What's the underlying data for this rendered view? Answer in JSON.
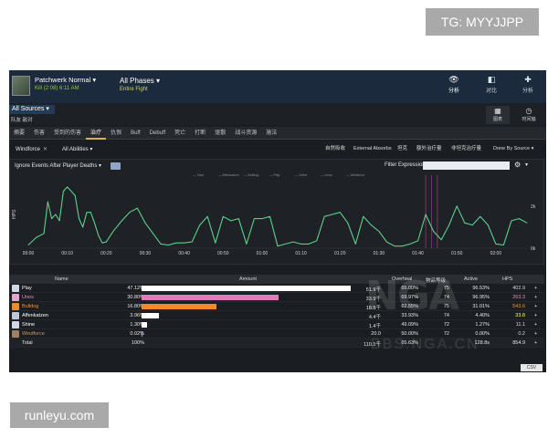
{
  "badges": {
    "tg": "TG: MYYJJPP",
    "site": "runleyu.com"
  },
  "header": {
    "boss_name": "Patchwerk Normal ▾",
    "kill_info": "Kill (2:08)  6:11 AM",
    "phase_title": "All Phases ▾",
    "phase_sub": "Entire Fight",
    "buttons": [
      {
        "icon": "eye-icon",
        "glyph": "👁",
        "label": "分析"
      },
      {
        "icon": "compare-icon",
        "glyph": "◧",
        "label": "对比"
      },
      {
        "icon": "puzzle-icon",
        "glyph": "✚",
        "label": "分析"
      }
    ]
  },
  "sources": {
    "label": "All Sources ▾",
    "sub": "队友  敌对",
    "views": [
      {
        "icon": "grid-icon",
        "glyph": "▦",
        "label": "图表"
      },
      {
        "icon": "clock-icon",
        "glyph": "◷",
        "label": "时间轴"
      }
    ]
  },
  "tabs": [
    "摘要",
    "伤害",
    "受到的伤害",
    "治疗",
    "仇恨",
    "Buff",
    "Debuff",
    "死亡",
    "打断",
    "驱散",
    "战斗资源",
    "施法"
  ],
  "active_tab": 3,
  "filters": {
    "source": "Windforce",
    "ability": "All Abilities ▾",
    "buttons": [
      "自然吸收",
      "External Absorbs",
      "坦克",
      "额外治疗量",
      "非坦克治疗量"
    ],
    "selected_button": 2,
    "sort": "Done By Source ▾"
  },
  "chart_panel": {
    "ignore_label": "Ignore Events After Player Deaths ▾",
    "filter_label": "Filter Expression:",
    "filter_value": "",
    "y_label": "HPS",
    "legend": [
      "— Total",
      "— Affenkatzen",
      "— Bulldog",
      "— Play",
      "— Shine",
      "— Unos",
      "— Windforce"
    ]
  },
  "chart_data": {
    "type": "line",
    "x_ticks": [
      "00:00",
      "00:10",
      "00:20",
      "00:30",
      "00:40",
      "00:50",
      "01:00",
      "01:10",
      "01:20",
      "01:30",
      "01:40",
      "01:50",
      "02:00"
    ],
    "y_ticks": [
      "2k",
      "0k"
    ],
    "xlim": [
      0,
      128
    ],
    "ylim": [
      0,
      3200
    ],
    "x": [
      0,
      2,
      4,
      5,
      6,
      7,
      8,
      9,
      10,
      12,
      13,
      14,
      15,
      16,
      17,
      18,
      19,
      20,
      22,
      24,
      26,
      28,
      30,
      32,
      34,
      36,
      38,
      40,
      42,
      44,
      46,
      48,
      50,
      52,
      54,
      56,
      58,
      60,
      62,
      64,
      66,
      68,
      70,
      72,
      74,
      76,
      78,
      80,
      82,
      84,
      86,
      88,
      90,
      92,
      94,
      96,
      98,
      100,
      102,
      104,
      106,
      108,
      110,
      112,
      114,
      116,
      118,
      120,
      122,
      124,
      126,
      128
    ],
    "y": [
      150,
      500,
      700,
      2200,
      1400,
      1600,
      1300,
      2700,
      2900,
      2500,
      1400,
      1000,
      1700,
      1700,
      1200,
      600,
      250,
      300,
      850,
      1300,
      1700,
      1900,
      1200,
      700,
      200,
      150,
      250,
      250,
      300,
      1100,
      1500,
      250,
      1500,
      1300,
      1400,
      200,
      1400,
      1400,
      1500,
      100,
      200,
      300,
      200,
      200,
      350,
      1500,
      1600,
      1700,
      1200,
      200,
      1500,
      1100,
      800,
      300,
      100,
      100,
      200,
      350,
      1600,
      800,
      400,
      1100,
      2000,
      1200,
      1100,
      1500,
      1100,
      200,
      150,
      1300,
      1400,
      1200
    ]
  },
  "table": {
    "headers": [
      "Name",
      "Amount",
      "Overheal",
      "物品等级",
      "Active",
      "HPS"
    ],
    "rows": [
      {
        "name": "Play",
        "icon": "priest-icon",
        "icon_color": "#d0d8e8",
        "name_color": "#ffffff",
        "pct": "47.12%",
        "fill": 0.9712,
        "bar_color": "#ffffff",
        "amount": "51.9千",
        "overheal": "65.00%",
        "ilvl": "75",
        "active": "96.53%",
        "hps": "402.9",
        "hps_color": "#d6dae0"
      },
      {
        "name": "Unos",
        "icon": "paladin-icon",
        "icon_color": "#e3a6d0",
        "name_color": "#e88fc0",
        "pct": "30.80%",
        "fill": 0.6348,
        "bar_color": "#e07ab8",
        "amount": "33.9千",
        "overheal": "69.97%",
        "ilvl": "74",
        "active": "96.95%",
        "hps": "263.3",
        "hps_color": "#e88fc0"
      },
      {
        "name": "Bulldog",
        "icon": "druid-icon",
        "icon_color": "#f08a2a",
        "name_color": "#ff9030",
        "pct": "16.80%",
        "fill": 0.3463,
        "bar_color": "#f08a2a",
        "amount": "18.5千",
        "overheal": "62.55%",
        "ilvl": "75",
        "active": "31.01%",
        "hps": "543.6",
        "hps_color": "#ff9030"
      },
      {
        "name": "Affenkatzen",
        "icon": "shaman-icon",
        "icon_color": "#c0c8d8",
        "name_color": "#ffffff",
        "pct": "3.96%",
        "fill": 0.0816,
        "bar_color": "#ffffff",
        "amount": "4.4千",
        "overheal": "33.93%",
        "ilvl": "74",
        "active": "4.40%",
        "hps": "33.8",
        "hps_color": "#ffff66"
      },
      {
        "name": "Shine",
        "icon": "priest-icon",
        "icon_color": "#d0d8e8",
        "name_color": "#ffffff",
        "pct": "1.30%",
        "fill": 0.0268,
        "bar_color": "#ffffff",
        "amount": "1.4千",
        "overheal": "49.09%",
        "ilvl": "72",
        "active": "1.27%",
        "hps": "11.1",
        "hps_color": "#d6dae0"
      },
      {
        "name": "Windforce",
        "icon": "warrior-icon",
        "icon_color": "#a08060",
        "name_color": "#c69b6d",
        "pct": "0.02%",
        "fill": 0.0004,
        "bar_color": "#c69b6d",
        "amount": "20.0",
        "overheal": "50.00%",
        "ilvl": "72",
        "active": "0.00%",
        "hps": "0.2",
        "hps_color": "#d6dae0"
      }
    ],
    "total": {
      "name": "Total",
      "pct": "100%",
      "amount": "110.1千",
      "overheal": "65.63%",
      "active": "128.8s",
      "hps": "854.9"
    }
  },
  "csv_label": "CSV",
  "watermark": {
    "logo": "NGA",
    "sub": "BBS.NGA.CN"
  }
}
